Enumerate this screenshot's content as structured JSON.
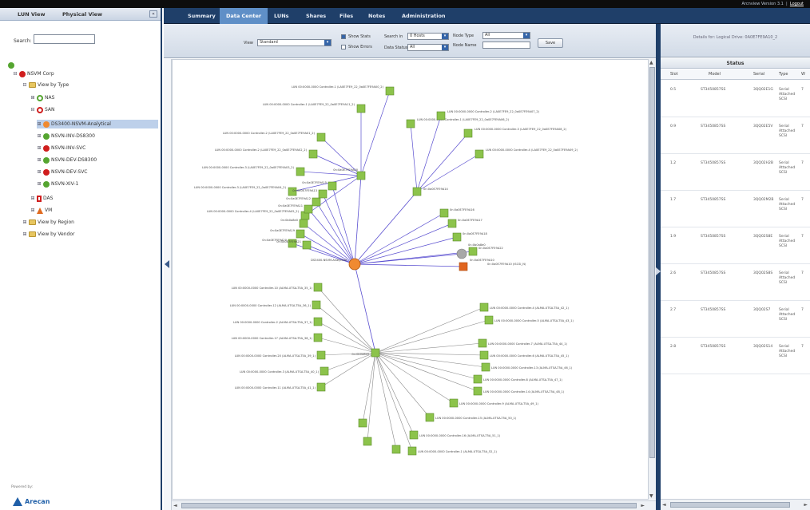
{
  "header": {
    "tabs": [
      "Summary",
      "Data Center",
      "LUNs",
      "Shares",
      "Files",
      "Notes",
      "Administration"
    ],
    "active_tab": "Data Center",
    "version": "Arcnview Version 3.1",
    "logout": "Logout"
  },
  "sidebar": {
    "tabs": [
      "LUN View",
      "Physical View"
    ],
    "search_label": "Search:",
    "search_value": "",
    "tree": [
      {
        "label": "NSVM Corp"
      },
      {
        "label": "View by Type"
      },
      {
        "label": "NAS"
      },
      {
        "label": "SAN"
      },
      {
        "label": "DS3400-NSVM-Analytical"
      },
      {
        "label": "NSVN-INV-DS8300"
      },
      {
        "label": "NSVN-INV-SVC"
      },
      {
        "label": "NSVN-DEV-DS8300"
      },
      {
        "label": "NSVN-DEV-SVC"
      },
      {
        "label": "NSVN-XIV-1"
      },
      {
        "label": "DAS"
      },
      {
        "label": "VM"
      },
      {
        "label": "View by Region"
      },
      {
        "label": "View by Vendor"
      }
    ],
    "powered_by": "Powered by:",
    "logo_text": "Arecan"
  },
  "toolbar": {
    "view_label": "View",
    "view_value": "Standard",
    "show_stats": "Show Stats",
    "show_errors": "Show Errors",
    "search_by_label": "Search in",
    "search_by_value": "0 Hosts",
    "data_status_label": "Data Status",
    "data_status_value": "All",
    "node_type_label": "Node Type",
    "node_type_value": "All",
    "node_name_label": "Node Name",
    "node_name_value": "",
    "save_label": "Save"
  },
  "graph": {
    "top_hub_label": "0n:0a0E7FE9A00",
    "mid_hub_label": "0n:0a0E7FE9A14",
    "switch_label": "0n:0b0a8e0",
    "root_label": "DS3400-NSVM-Analytical",
    "array_label": "0n:0a0E7FE9A10",
    "array_link_label": "0n:0a0E7FE9A10 (iSCSI_N)",
    "upper_labels": [
      "LUN 00:0000-0000 Controller-1 (LA0E7FE9_22_0a0E7FE9A11_2)",
      "LUN 00:0000-0000 Controller-1 (LA0E7FE9_22_0a0E7FE9A00_2)",
      "LUN 00:0000-0000 Controller-2 (LA0E7FE9_22_0a0E7FE9A01_2)",
      "LUN 00:0000-0000 Controller-2 (LA0E7FE9_22_0a0E7FE9A02_2)",
      "LUN 00:0000-0000 Controller-3 (LA0E7FE9_22_0a0E7FE9A03_2)",
      "LUN 00:0000-0000 Controller-3 (LA0E7FE9_22_0a0E7FE9A04_2)",
      "LUN 00:0000-0000 Controller-4 (LA0E7FE9_22_0a0E7FE9A05_2)",
      "LUN 00:0000-0000 Controller-1 (LA0E7FE9_22_0a0E7FE9A06_2)",
      "LUN 00:0000-0000 Controller-2 (LA0E7FE9_22_0a0E7FE9A07_2)",
      "LUN 00:0000-0000 Controller-3 (LA0E7FE9_22_0a0E7FE9A08_2)",
      "LUN 00:0000-0000 Controller-4 (LA0E7FE9_22_0a0E7FE9A09_2)"
    ],
    "mid_labels": [
      "0n:0b0a8e0",
      "0n:0a0E7FE9A11",
      "0n:0a0E7FE9A12",
      "0n:0a0E7FE9A13",
      "0n:0a0E7FE9A15",
      "0n:0a0E7FE9A16",
      "0n:0a0E7FE9A17",
      "0n:0a0E7FE9A18",
      "0n:0a0E7FE9A19",
      "0n:0a0E7FE9A20",
      "0n:0a0E7FE9A21",
      "0n:0a0E7FE9A22"
    ],
    "lower_labels": [
      "LUN 00:0000-0000 Controller-10 (ALMA-UTSA-T5A_35_1)",
      "LUN 00:0000-0000 Controller-12 (ALMA-UTSA-T5A_36_1)",
      "LUN 00:0000-0000 Controller-2 (ALMA-UTSA-T5A_37_1)",
      "LUN 00:0000-0000 Controller-17 (ALMA-UTSA-T5A_38_1)",
      "LUN 00:0000-0000 Controller-20 (ALMA-UTSA-T5A_39_1)",
      "LUN 00:0000-0000 Controller-3 (ALMA-UTSA-T5A_40_1)",
      "LUN 00:0000-0000 Controller-11 (ALMA-UTSA-T5A_41_1)",
      "LUN 00:0000-0000 Controller-4 (ALMA-UTSA-T5A_42_1)",
      "LUN 00:0000-0000 Controller-5 (ALMA-UTSA-T5A_43_1)",
      "LUN 00:0000-0000 Controller-7 (ALMA-UTSA-T5A_44_1)",
      "LUN 00:0000-0000 Controller-6 (ALMA-UTSA-T5A_45_1)",
      "LUN 00:0000-0000 Controller-13 (ALMA-UTSA-T5A_46_1)",
      "LUN 00:0000-0000 Controller-8 (ALMA-UTSA-T5A_47_1)",
      "LUN 00:0000-0000 Controller-14 (ALMA-UTSA-T5A_48_1)",
      "LUN 00:0000-0000 Controller-9 (ALMA-UTSA-T5A_49_1)",
      "LUN 00:0000-0000 Controller-15 (ALMA-UTSA-T5A_50_1)",
      "LUN 00:0000-0000 Controller-16 (ALMA-UTSA-T5A_51_1)",
      "LUN 00:0000-0000 Controller-1 (ALMA-UTSA-T5A_52_1)"
    ],
    "colors": {
      "hub_line": "#5a4fd0",
      "lower_line": "#8a8a8a",
      "node_green": "#8cc34b",
      "root_orange": "#f08a30",
      "array_orange": "#e0651f"
    }
  },
  "details": {
    "title": "Details for: Logical Drive: 0A0E7FE9A10_2",
    "status_header": "Status",
    "columns": [
      "Slot",
      "Model",
      "Serial",
      "Type",
      "W"
    ],
    "rows": [
      {
        "slot": "0.5",
        "model": "ST3450857SS",
        "serial": "3QQ02E1G",
        "type": "Serial Attached SCSI",
        "w": "7"
      },
      {
        "slot": "0.9",
        "model": "ST3450857SS",
        "serial": "3QQ02E5V",
        "type": "Serial Attached SCSI",
        "w": "7"
      },
      {
        "slot": "1.2",
        "model": "ST3450857SS",
        "serial": "3QQ02H2B",
        "type": "Serial Attached SCSI",
        "w": "7"
      },
      {
        "slot": "1.7",
        "model": "ST3450857SS",
        "serial": "3QQ02M2B",
        "type": "Serial Attached SCSI",
        "w": "7"
      },
      {
        "slot": "1.9",
        "model": "ST3450857SS",
        "serial": "3QQ02S8E",
        "type": "Serial Attached SCSI",
        "w": "7"
      },
      {
        "slot": "2.6",
        "model": "ST3450857SS",
        "serial": "3QQ02S8S",
        "type": "Serial Attached SCSI",
        "w": "7"
      },
      {
        "slot": "2.7",
        "model": "ST3450857SS",
        "serial": "3QQ02S7",
        "type": "Serial Attached SCSI",
        "w": "7"
      },
      {
        "slot": "2.8",
        "model": "ST3450857SS",
        "serial": "3QQ02S14",
        "type": "Serial Attached SCSI",
        "w": "7"
      }
    ]
  }
}
